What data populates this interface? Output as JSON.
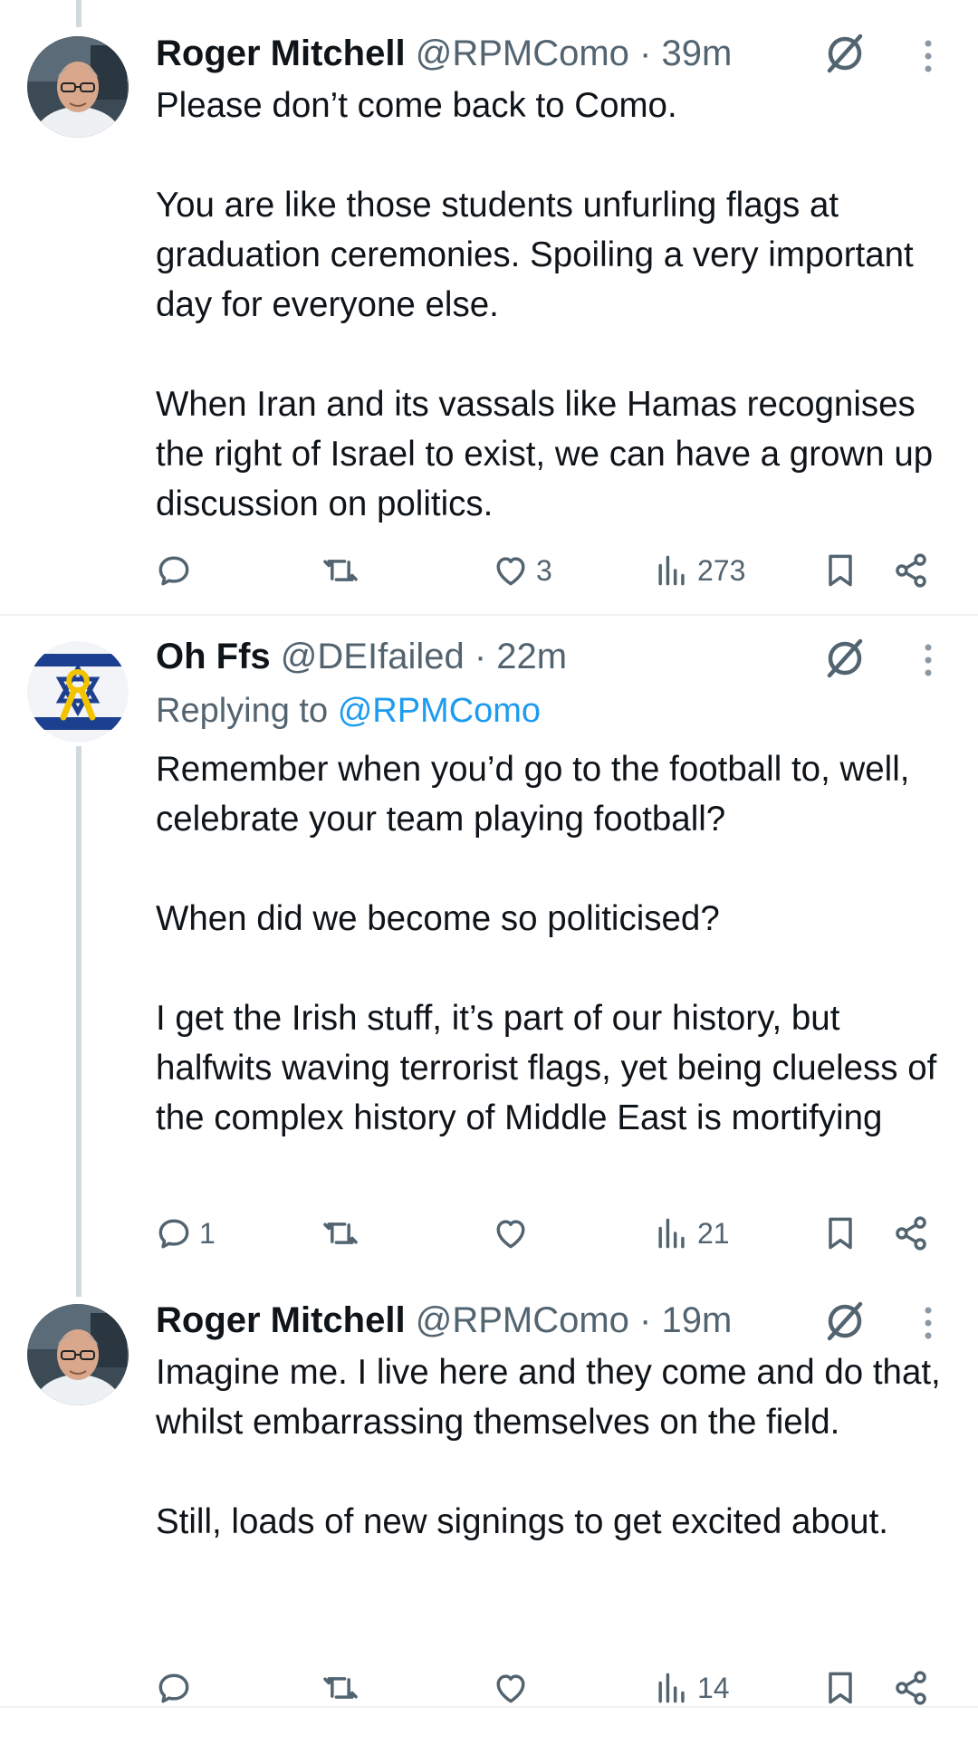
{
  "tweets": [
    {
      "name": "Roger Mitchell",
      "handle": "@RPMComo",
      "time": "· 39m",
      "replying_label": "",
      "replying_mention": "",
      "text": "Please don’t come back to Como.\n\nYou are like those students unfurling flags at graduation ceremonies. Spoiling a very important day for everyone else.\n\nWhen Iran and its vassals like Hamas recognises the right of Israel to exist, we can have a grown up discussion on politics.",
      "replies": "",
      "retweets": "",
      "likes": "3",
      "views": "273"
    },
    {
      "name": "Oh Ffs",
      "handle": "@DEIfailed",
      "time": "· 22m",
      "replying_label": "Replying to",
      "replying_mention": "@RPMComo",
      "text": "Remember when you’d go to the football to, well, celebrate your team playing football?\n\nWhen did we become so politicised?\n\nI get the Irish stuff, it’s part of our history, but halfwits waving terrorist flags, yet being clueless of the complex history of Middle East is mortifying",
      "replies": "1",
      "retweets": "",
      "likes": "",
      "views": "21"
    },
    {
      "name": "Roger Mitchell",
      "handle": "@RPMComo",
      "time": "· 19m",
      "replying_label": "",
      "replying_mention": "",
      "text": "Imagine me. I live here and they come and do that, whilst embarrassing themselves on the field.\n\nStill, loads of new signings to get excited about.",
      "replies": "",
      "retweets": "",
      "likes": "",
      "views": "14"
    }
  ],
  "icons": {
    "reply": "reply-icon",
    "retweet": "retweet-icon",
    "like": "heart-icon",
    "views": "views-icon",
    "bookmark": "bookmark-icon",
    "share": "share-icon",
    "grok": "grok-icon",
    "more": "more-vertical-icon"
  },
  "colors": {
    "text": "#0f1419",
    "secondary": "#536471",
    "link": "#1d9bf0",
    "divider": "#eff3f4",
    "thread_line": "#cfd9de"
  }
}
